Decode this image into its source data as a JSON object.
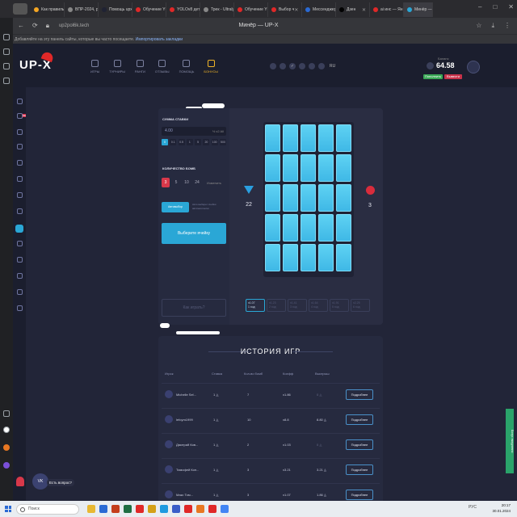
{
  "browser": {
    "tabs": [
      {
        "label": "Как правильн",
        "color": "#f5a623"
      },
      {
        "label": "ВПР-2024, ру",
        "color": "#888888"
      },
      {
        "label": "Помощь upx",
        "color": "#1f2233"
      },
      {
        "label": "Обучение YC",
        "color": "#e02828"
      },
      {
        "label": "YOLOv8 детек",
        "color": "#e02828"
      },
      {
        "label": "Трек - Ultralyt",
        "color": "#888888"
      },
      {
        "label": "Обучение YC",
        "color": "#e02828"
      },
      {
        "label": "Выбор ч",
        "color": "#e02828"
      },
      {
        "label": "Мессенджер",
        "color": "#2a6ad4"
      },
      {
        "label": "Дзен",
        "color": "#000000"
      },
      {
        "label": "ai инс — Ян",
        "color": "#e02828"
      },
      {
        "label": "Минёр —",
        "color": "#2aa7d6"
      }
    ],
    "url": "up2pol6k.tech",
    "page_title": "Минёр — UP-X",
    "bookmark_hint": "Добавляйте на эту панель сайты, которые вы часто посещаете.",
    "bookmark_link": "Импортировать закладки"
  },
  "site": {
    "logo": "UP-X",
    "nav": [
      {
        "label": "ИГРЫ",
        "active": false
      },
      {
        "label": "ТУРНИРЫ",
        "active": false
      },
      {
        "label": "РАНГИ",
        "active": false
      },
      {
        "label": "ОТЗЫВЫ",
        "active": false
      },
      {
        "label": "ПОМОЩЬ",
        "active": false
      },
      {
        "label": "БОНУСЫ",
        "active": true
      }
    ],
    "lang": "RU",
    "balance_label": "Баланс",
    "balance": "64.58",
    "deposit_label": "Пополнить",
    "withdraw_label": "Вывести"
  },
  "game": {
    "bet_title": "СУММА СТАВКИ",
    "bet_value": "4.00",
    "bet_mods": "½   x2   All",
    "quick_bets": [
      "0",
      "0.1",
      "0.5",
      "1",
      "5",
      "20",
      "100",
      "500"
    ],
    "bombs_title": "КОЛИЧЕСТВО БОМБ",
    "bomb_options": [
      "3",
      "5",
      "10",
      "24"
    ],
    "bomb_selected": "3",
    "bomb_change": "Изменить",
    "auto_label": "Автовыбор",
    "auto_hint": "Авто выберет ячейки автоматически",
    "main_button": "Выберите ячейку",
    "cashout_button": "Как играть?",
    "gems_count": "22",
    "bombs_count": "3",
    "coefs": [
      {
        "value": "x1.07",
        "sub": "1 ход"
      },
      {
        "value": "x1.23",
        "sub": "2 ход"
      },
      {
        "value": "x1.41",
        "sub": "3 ход"
      },
      {
        "value": "x1.64",
        "sub": "4 ход"
      },
      {
        "value": "x1.91",
        "sub": "5 ход"
      },
      {
        "value": "x2.25",
        "sub": "6 ход"
      }
    ]
  },
  "history": {
    "title": "ИСТОРИЯ ИГР",
    "columns": [
      "Игрок",
      "Ставка",
      "Кол-во бомб",
      "Коэфф",
      "Выигрыш"
    ],
    "rows": [
      {
        "player": "Michelle Sel...",
        "bet": "1",
        "bombs": "7",
        "coef": "x1.86",
        "win": "0",
        "zero": true
      },
      {
        "player": "lefoym1999",
        "bet": "1",
        "bombs": "10",
        "coef": "x8.8",
        "win": "8.80",
        "zero": false
      },
      {
        "player": "Дмитрий Ков...",
        "bet": "1",
        "bombs": "2",
        "coef": "x1.03",
        "win": "0",
        "zero": true
      },
      {
        "player": "Тимофей Коп...",
        "bet": "1",
        "bombs": "3",
        "coef": "x3.21",
        "win": "3.21",
        "zero": false
      },
      {
        "player": "Макс Том...",
        "bet": "1",
        "bombs": "3",
        "coef": "x1.07",
        "win": "1.86",
        "zero": false
      }
    ],
    "more_label": "Подробнее"
  },
  "chat": {
    "label": "Есть вопрос?",
    "badge": "VK"
  },
  "side_ad": "Бонус ежедневно",
  "taskbar": {
    "search_placeholder": "Поиск",
    "lang": "РУС",
    "time": "20:17",
    "date": "30.01.2024",
    "apps": [
      "#e8b832",
      "#2a6ad4",
      "#c43e1c",
      "#1f6e43",
      "#e02828",
      "#d4a017",
      "#1e9ae0",
      "#3a5dc8",
      "#e02828",
      "#e87722",
      "#e02828",
      "#4285f4"
    ]
  }
}
